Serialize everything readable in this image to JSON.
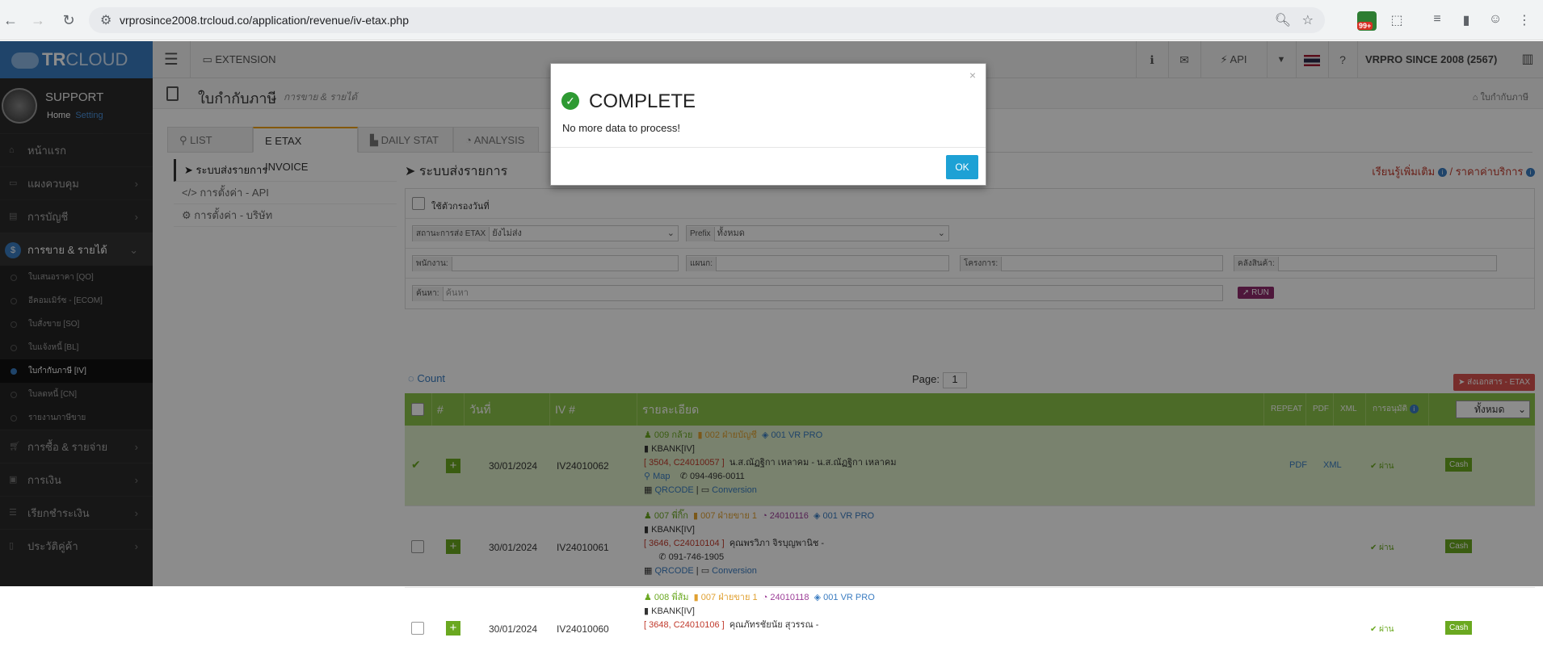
{
  "browser": {
    "url": "vrprosince2008.trcloud.co/application/revenue/iv-etax.php",
    "ext_badge": "99+"
  },
  "topbar": {
    "logo_a": "TR",
    "logo_b": "CLOUD",
    "extension": "EXTENSION",
    "api": "API",
    "company": "VRPRO SINCE 2008 (2567)"
  },
  "profile": {
    "name": "SUPPORT",
    "home": "Home",
    "setting": "Setting"
  },
  "menu": [
    {
      "label": "หน้าแรก",
      "arrow": ""
    },
    {
      "label": "แผงควบคุม",
      "arrow": "›"
    },
    {
      "label": "การบัญชี",
      "arrow": "›"
    },
    {
      "label": "การขาย & รายได้",
      "arrow": "⌄"
    }
  ],
  "submenu": [
    "ใบเสนอราคา [QO]",
    "อีคอมเมิร์ซ - [ECOM]",
    "ใบสั่งขาย [SO]",
    "ใบแจ้งหนี้ [BL]",
    "ใบกำกับภาษี [IV]",
    "ใบลดหนี้ [CN]",
    "รายงานภาษีขาย"
  ],
  "menu2": [
    {
      "label": "การซื้อ & รายจ่าย",
      "arrow": "›"
    },
    {
      "label": "การเงิน",
      "arrow": "›"
    },
    {
      "label": "เรียกชำระเงิน",
      "arrow": "›"
    },
    {
      "label": "ประวัติคู่ค้า",
      "arrow": "›"
    }
  ],
  "page": {
    "title": "ใบกำกับภาษี",
    "subtitle": "การขาย & รายได้",
    "crumb": "ใบกำกับภาษี"
  },
  "tabs": [
    "LIST",
    "ETAX INVOICE",
    "DAILY STAT",
    "ANALYSIS"
  ],
  "leftmenu": [
    "ระบบส่งรายการ",
    "การตั้งค่า - API",
    "การตั้งค่า - บริษัท"
  ],
  "panel": {
    "title": "ระบบส่งรายการ",
    "learn": "เรียนรู้เพิ่มเติม",
    "price": "ราคาค่าบริการ"
  },
  "filters": {
    "use_date": "ใช้ตัวกรองวันที่",
    "etax_status_label": "สถานะการส่ง ETAX",
    "etax_status_value": "ยังไม่ส่ง",
    "prefix_label": "Prefix",
    "prefix_value": "ทั้งหมด",
    "staff_label": "พนักงาน:",
    "dept_label": "แผนก:",
    "project_label": "โครงการ:",
    "warehouse_label": "คลังสินค้า:",
    "search_label": "ค้นหา:",
    "search_placeholder": "ค้นหา",
    "run": "RUN"
  },
  "list": {
    "count": "Count",
    "page_label": "Page:",
    "page": "1",
    "send_btn": "ส่งเอกสาร - ETAX"
  },
  "table": {
    "cols": [
      "#",
      "วันที่",
      "IV #",
      "รายละเอียด",
      "REPEAT",
      "PDF",
      "XML",
      "การอนุมัติ"
    ],
    "filter": "ทั้งหมด"
  },
  "rows": [
    {
      "date": "30/01/2024",
      "iv": "IV24010062",
      "person": "009 กล้วย",
      "book": "002 ฝ่ายบัญชี",
      "doc": "",
      "branch": "001 VR PRO",
      "bank": "KBANK[IV]",
      "codes": "[ 3504, C24010057 ]",
      "customer": "น.ส.ณัฏฐิกา เหลาคม - น.ส.ณัฏฐิกา เหลาคม",
      "map": "Map",
      "phone": "094-496-0011",
      "qr": "QRCODE",
      "conv": "Conversion",
      "pdf": "PDF",
      "xml": "XML",
      "approve": "ผ่าน",
      "pay": "Cash"
    },
    {
      "date": "30/01/2024",
      "iv": "IV24010061",
      "person": "007 พี่กิ๊ก",
      "book": "007 ฝ่ายขาย 1",
      "doc": "24010116",
      "branch": "001 VR PRO",
      "bank": "KBANK[IV]",
      "codes": "[ 3646, C24010104 ]",
      "customer": "คุณพรวิภา จิรบุญพานิช -",
      "map": "",
      "phone": "091-746-1905",
      "qr": "QRCODE",
      "conv": "Conversion",
      "pdf": "",
      "xml": "",
      "approve": "ผ่าน",
      "pay": "Cash"
    },
    {
      "date": "30/01/2024",
      "iv": "IV24010060",
      "person": "008 พี่ส้ม",
      "book": "007 ฝ่ายขาย 1",
      "doc": "24010118",
      "branch": "001 VR PRO",
      "bank": "KBANK[IV]",
      "codes": "[ 3648, C24010106 ]",
      "customer": "คุณภัทรชัยนัย สุวรรณ -",
      "map": "",
      "phone": "",
      "qr": "",
      "conv": "",
      "pdf": "",
      "xml": "",
      "approve": "ผ่าน",
      "pay": "Cash"
    }
  ],
  "modal": {
    "title": "COMPLETE",
    "text": "No more data to process!",
    "ok": "OK",
    "close": "×"
  }
}
